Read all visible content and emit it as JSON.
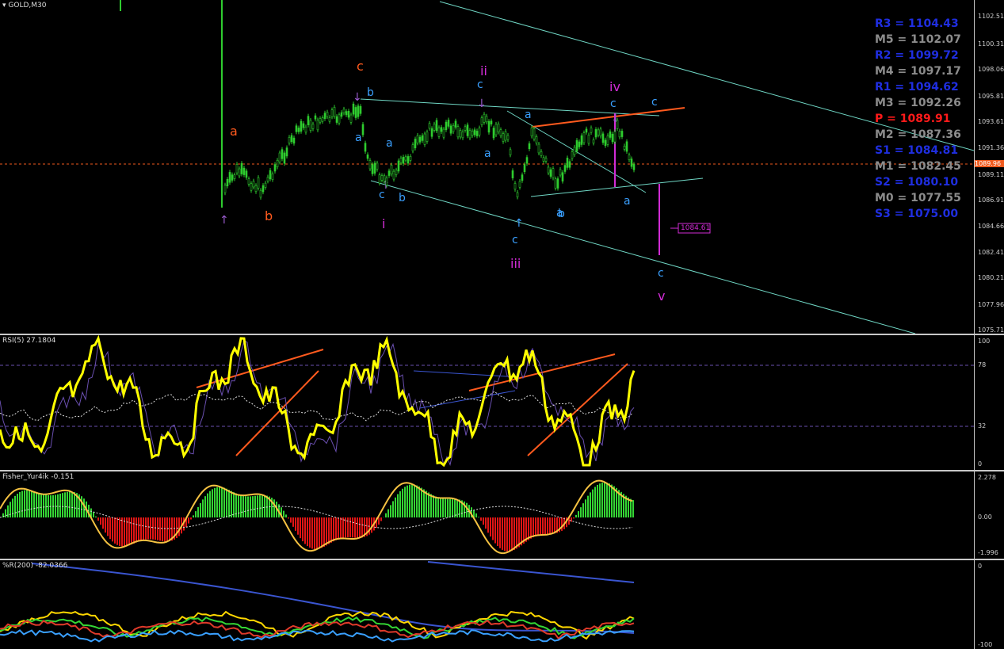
{
  "main": {
    "symbol_label": "GOLD,M30",
    "price_axis": [
      "1102.51",
      "1100.31",
      "1098.06",
      "1095.81",
      "1093.61",
      "1091.36",
      "1089.11",
      "1086.91",
      "1084.66",
      "1082.41",
      "1080.21",
      "1077.96",
      "1075.71"
    ],
    "current_price_tag": "1089.96",
    "target_label": "1084.61",
    "pivots": [
      {
        "name": "R3",
        "text": "R3 = 1104.43",
        "color": "#1f2ee0"
      },
      {
        "name": "M5",
        "text": "M5 = 1102.07",
        "color": "#8c8c8c"
      },
      {
        "name": "R2",
        "text": "R2 = 1099.72",
        "color": "#1f2ee0"
      },
      {
        "name": "M4",
        "text": "M4 = 1097.17",
        "color": "#8c8c8c"
      },
      {
        "name": "R1",
        "text": "R1 = 1094.62",
        "color": "#1f2ee0"
      },
      {
        "name": "M3",
        "text": "M3 = 1092.26",
        "color": "#8c8c8c"
      },
      {
        "name": "P",
        "text": "P  = 1089.91",
        "color": "#ff1a1a"
      },
      {
        "name": "M2",
        "text": "M2 = 1087.36",
        "color": "#8c8c8c"
      },
      {
        "name": "S1",
        "text": "S1 = 1084.81",
        "color": "#1f2ee0"
      },
      {
        "name": "M1",
        "text": "M1 = 1082.45",
        "color": "#8c8c8c"
      },
      {
        "name": "S2",
        "text": "S2 = 1080.10",
        "color": "#1f2ee0"
      },
      {
        "name": "M0",
        "text": "M0 = 1077.55",
        "color": "#8c8c8c"
      },
      {
        "name": "S3",
        "text": "S3 = 1075.00",
        "color": "#1f2ee0"
      }
    ],
    "wave_labels": [
      "a",
      "b",
      "c",
      "b",
      "a",
      "c",
      "b",
      "a",
      "i",
      "c",
      "a",
      "a",
      "ii",
      "c",
      "a",
      "c",
      "iii",
      "c",
      "iv",
      "b",
      "a",
      "b",
      "c",
      "v"
    ]
  },
  "rsi": {
    "title": "RSI(5) 27.1804",
    "axis": [
      "100",
      "78",
      "32",
      "0"
    ]
  },
  "fisher": {
    "title": "Fisher_Yur4ik -0.151",
    "axis": [
      "2.278",
      "0.00",
      "-1.996"
    ]
  },
  "wpr": {
    "title": "%R(200) -82.0366",
    "axis": [
      "0",
      "-100"
    ]
  },
  "colors": {
    "candle": "#2ecc2e",
    "channel": "#6fd6c4",
    "wave_orange": "#ff5a1e",
    "wave_blue": "#3aa0ff",
    "wave_magenta": "#d22cd6",
    "rsi": "#ffff00",
    "fisher_pos": "#34d634",
    "fisher_neg": "#e01515"
  }
}
